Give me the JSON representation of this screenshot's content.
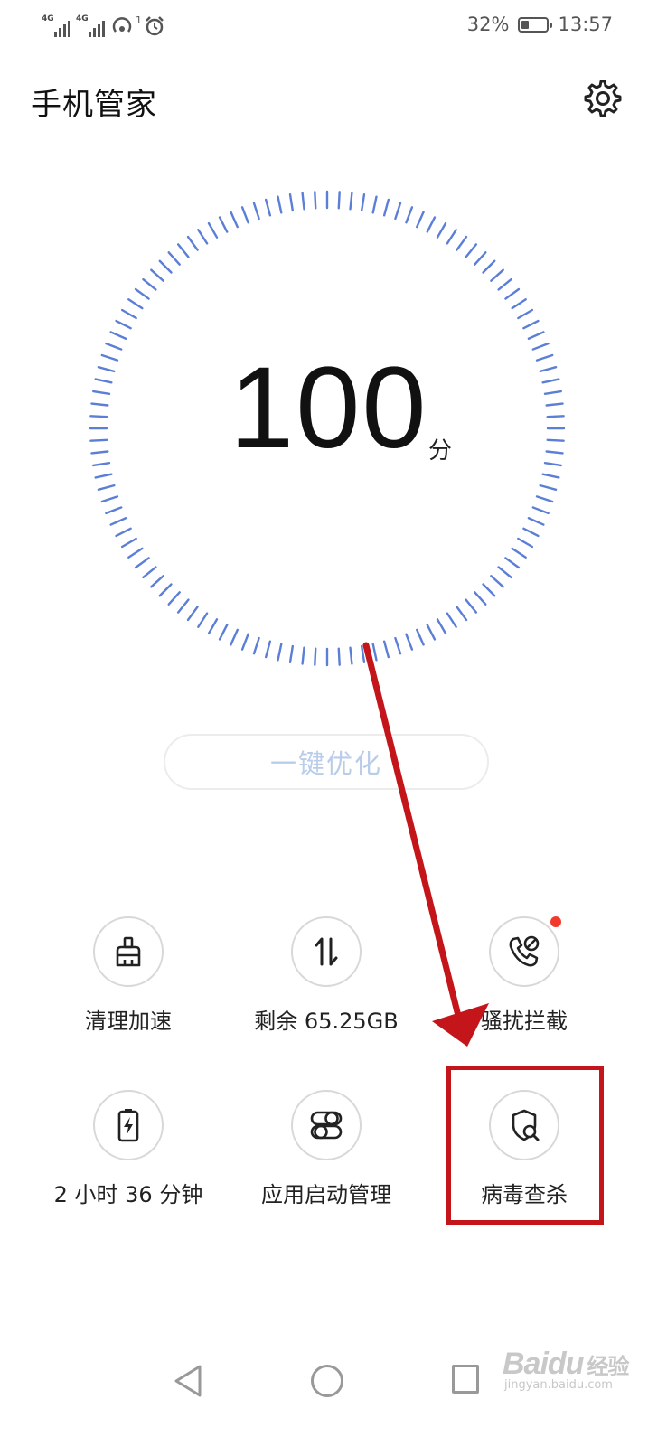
{
  "status_bar": {
    "sim1_label": "4G",
    "sim2_label": "4G",
    "notification_badge": "1",
    "battery_percent_text": "32%",
    "battery_level": 0.32,
    "time": "13:57"
  },
  "header": {
    "title": "手机管家",
    "settings_icon": "gear-icon"
  },
  "score": {
    "value": "100",
    "unit": "分",
    "dial_color": "#5b7ed6"
  },
  "optimize_button": {
    "label": "一键优化",
    "text_color": "#b9cdea"
  },
  "tools": [
    {
      "label": "清理加速",
      "icon": "broom-icon"
    },
    {
      "label": "剩余 65.25GB",
      "icon": "data-transfer-icon"
    },
    {
      "label": "骚扰拦截",
      "icon": "phone-block-icon",
      "has_badge": true
    },
    {
      "label": "2 小时 36 分钟",
      "icon": "battery-charge-icon"
    },
    {
      "label": "应用启动管理",
      "icon": "toggle-switch-icon"
    },
    {
      "label": "病毒查杀",
      "icon": "shield-search-icon"
    }
  ],
  "annotation": {
    "color": "#c4161a",
    "target": "病毒查杀"
  },
  "nav_bar": {
    "back_icon": "back-triangle-icon",
    "home_icon": "home-circle-icon",
    "recent_icon": "recent-square-icon"
  },
  "watermark": {
    "logo": "Baidu",
    "logo_cn": "经验",
    "url": "jingyan.baidu.com"
  }
}
